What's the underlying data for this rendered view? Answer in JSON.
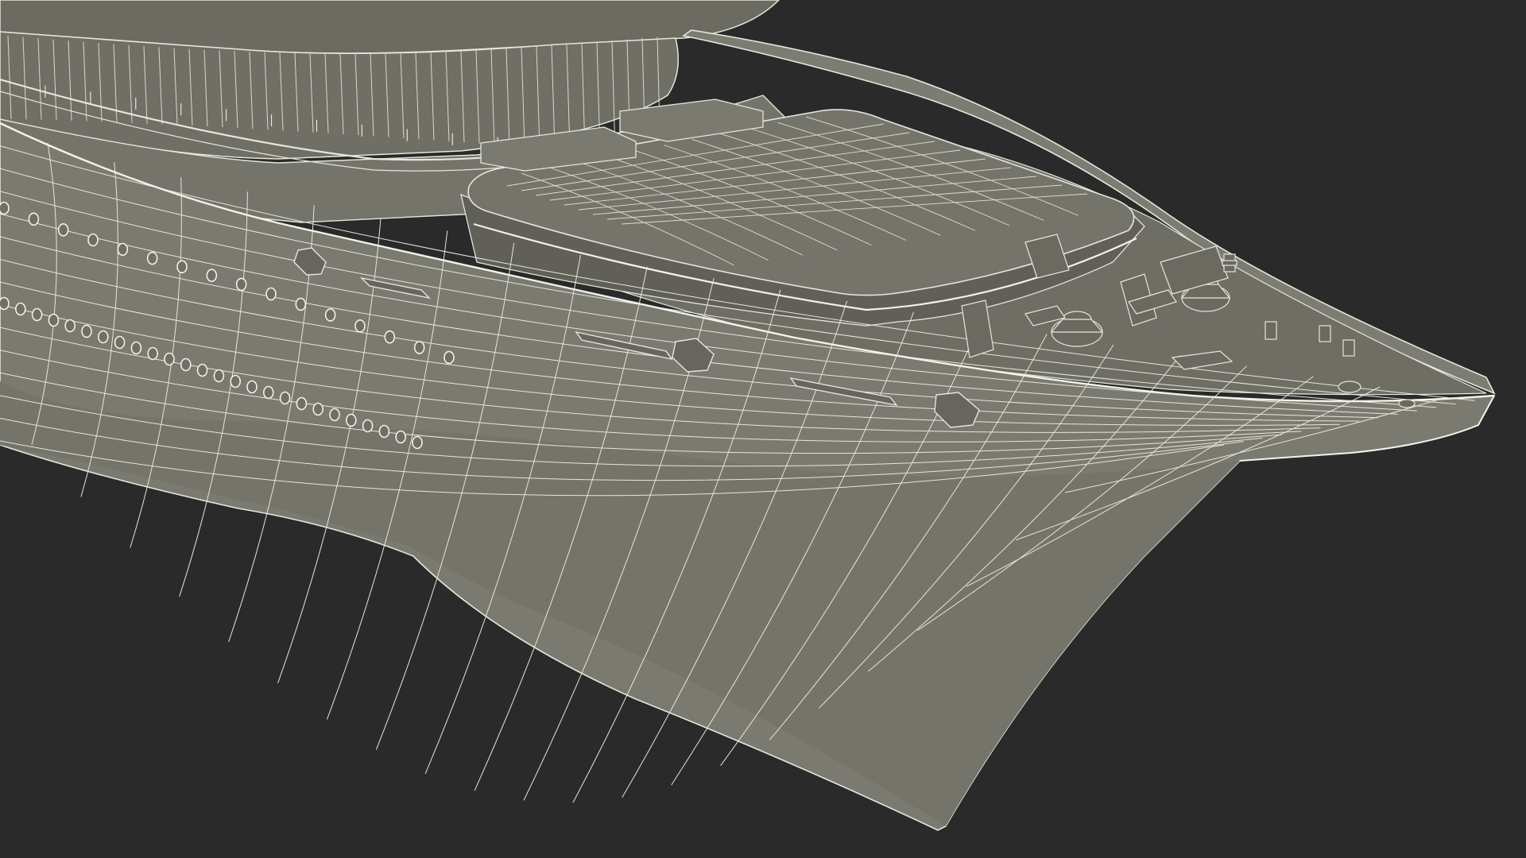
{
  "scene": {
    "subject": "ship-bow-wireframe-render",
    "colors": {
      "background": "#2a2a2a",
      "hull_fill": "#7a7a70",
      "hull_lower_fill": "#74746a",
      "deck_fill": "#6e6e65",
      "superstructure_fill": "#6b6b62",
      "hatch_fill": "#72726a",
      "wire": "#e6e6dc",
      "wire_dim": "#c9c9bd",
      "shadow": "#55554e"
    },
    "portholes": {
      "upper_row_count": 16,
      "lower_row_count": 26
    },
    "deck_equipment": [
      "windlass",
      "anchor-winch",
      "capstan",
      "bollard",
      "chain-pipe",
      "fairlead"
    ]
  }
}
